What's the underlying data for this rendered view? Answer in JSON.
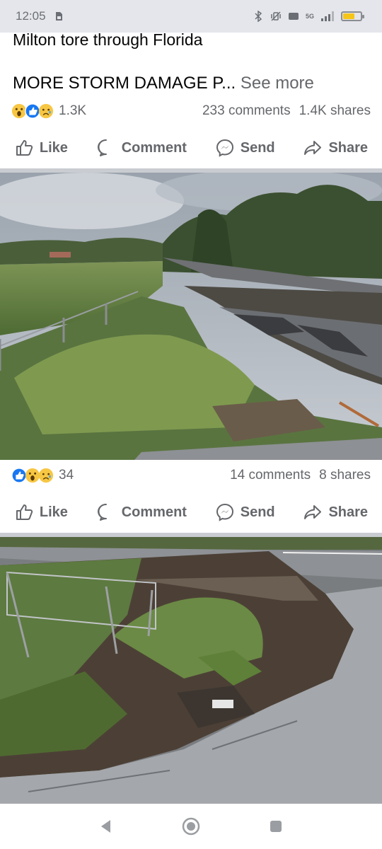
{
  "status_bar": {
    "time": "12:05",
    "network": "5G"
  },
  "post1": {
    "title": "Milton tore through Florida",
    "caption": "MORE STORM DAMAGE P...",
    "see_more": "See more",
    "reaction_count": "1.3K",
    "comments": "233 comments",
    "shares": "1.4K shares"
  },
  "post2": {
    "reaction_count": "34",
    "comments": "14 comments",
    "shares": "8 shares"
  },
  "actions": {
    "like": "Like",
    "comment": "Comment",
    "send": "Send",
    "share": "Share"
  },
  "colors": {
    "facebook_blue": "#1877f2",
    "muted": "#65676b",
    "divider": "#c9ccd1",
    "status_bar_bg": "#e4e6eb"
  }
}
